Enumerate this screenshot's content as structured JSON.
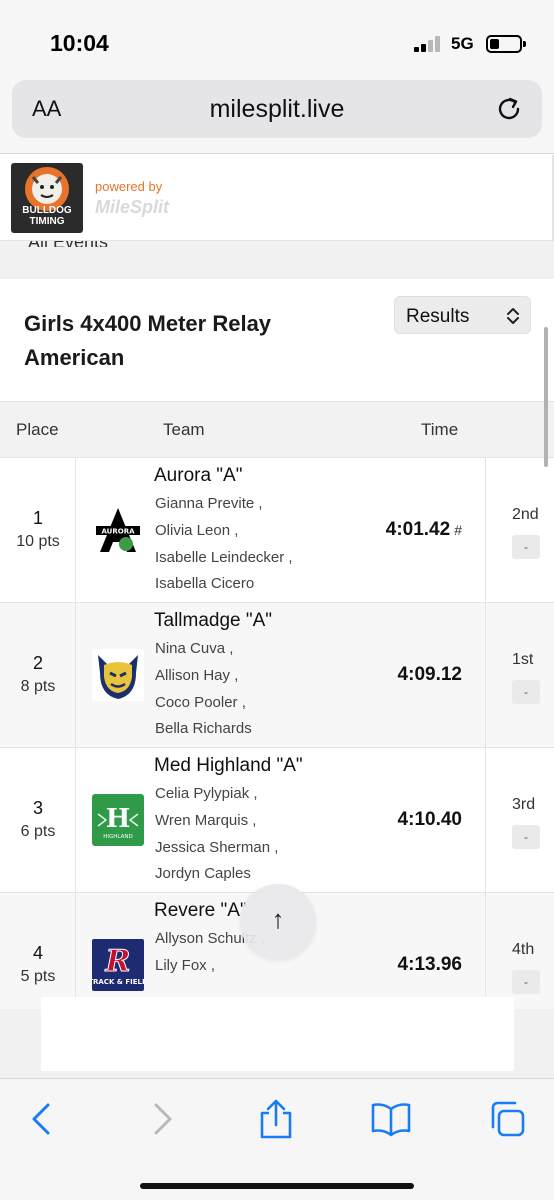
{
  "status_bar": {
    "time": "10:04",
    "network": "5G"
  },
  "browser": {
    "text_size_label": "AA",
    "url": "milesplit.live"
  },
  "site_header": {
    "logo_text": "BULLDOG TIMING",
    "powered_by": "powered by",
    "brand": "MileSplit"
  },
  "cut_text": "All Events",
  "event": {
    "title_line1": "Girls 4x400 Meter Relay",
    "title_line2": "American",
    "view_select": "Results"
  },
  "table": {
    "headers": {
      "place": "Place",
      "team": "Team",
      "time": "Time"
    },
    "rows": [
      {
        "place": "1",
        "points": "10 pts",
        "team": "Aurora \"A\"",
        "athletes": [
          "Gianna Previte ,",
          "Olivia Leon ,",
          "Isabelle Leindecker ,",
          "Isabella Cicero"
        ],
        "time": "4:01.42",
        "time_mark": "#",
        "heat_place": "2nd",
        "badge": "-"
      },
      {
        "place": "2",
        "points": "8 pts",
        "team": "Tallmadge \"A\"",
        "athletes": [
          "Nina Cuva ,",
          "Allison Hay ,",
          "Coco Pooler ,",
          "Bella Richards"
        ],
        "time": "4:09.12",
        "time_mark": "",
        "heat_place": "1st",
        "badge": "-"
      },
      {
        "place": "3",
        "points": "6 pts",
        "team": "Med Highland \"A\"",
        "athletes": [
          "Celia Pylypiak ,",
          "Wren Marquis ,",
          "Jessica Sherman ,",
          "Jordyn Caples"
        ],
        "time": "4:10.40",
        "time_mark": "",
        "heat_place": "3rd",
        "badge": "-"
      },
      {
        "place": "4",
        "points": "5 pts",
        "team": "Revere \"A\"",
        "athletes": [
          "Allyson Schultz ,",
          "Lily Fox ,"
        ],
        "time": "4:13.96",
        "time_mark": "",
        "heat_place": "4th",
        "badge": "-"
      }
    ]
  },
  "team_logos": {
    "aurora": {
      "letter": "A",
      "word": "AURORA"
    },
    "highland": {
      "letter": "H",
      "word": "HIGHLAND"
    },
    "revere": {
      "letter": "R",
      "word": "TRACK & FIELD"
    }
  },
  "scroll_top_symbol": "↑",
  "colors": {
    "brand_orange": "#e8742b",
    "tallmadge_navy": "#1b2f6b",
    "tallmadge_gold": "#e8c33c",
    "highland_green": "#2f9a47",
    "revere_navy": "#1d2b73",
    "revere_red": "#c8102e",
    "safari_blue": "#1a7cf5"
  }
}
